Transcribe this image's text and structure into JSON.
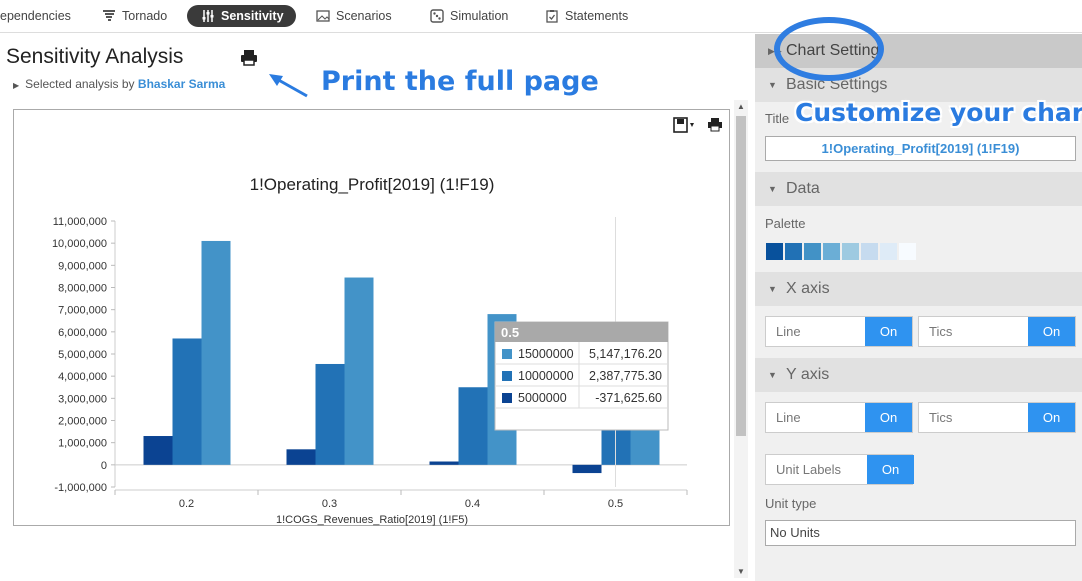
{
  "tabs": [
    {
      "label": "ependencies",
      "icon": "dependencies-icon"
    },
    {
      "label": "Tornado",
      "icon": "tornado-icon"
    },
    {
      "label": "Sensitivity",
      "icon": "sliders-icon"
    },
    {
      "label": "Scenarios",
      "icon": "image-icon"
    },
    {
      "label": "Simulation",
      "icon": "dice-icon"
    },
    {
      "label": "Statements",
      "icon": "clipboard-check-icon"
    }
  ],
  "page": {
    "title": "Sensitivity Analysis",
    "subtitle_prefix": "Selected analysis by",
    "author": "Bhaskar Sarma"
  },
  "annotations": {
    "print": "Print the full page",
    "customize": "Customize your chart"
  },
  "chart_data": {
    "type": "bar",
    "title": "1!Operating_Profit[2019] (1!F19)",
    "xlabel": "1!COGS_Revenues_Ratio[2019] (1!F5)",
    "ylabel": "",
    "categories": [
      "0.2",
      "0.3",
      "0.4",
      "0.5"
    ],
    "series": [
      {
        "name": "5000000",
        "color": "#0b4392",
        "values": [
          1300000,
          700000,
          150000,
          -371625.6
        ]
      },
      {
        "name": "10000000",
        "color": "#2272b6",
        "values": [
          5700000,
          4550000,
          3500000,
          2387775.3
        ]
      },
      {
        "name": "15000000",
        "color": "#4393c8",
        "values": [
          10100000,
          8450000,
          6800000,
          5147176.2
        ]
      }
    ],
    "ylim": [
      -1000000,
      11000000
    ],
    "yticks": [
      "11,000,000",
      "10,000,000",
      "9,000,000",
      "8,000,000",
      "7,000,000",
      "6,000,000",
      "5,000,000",
      "4,000,000",
      "3,000,000",
      "2,000,000",
      "1,000,000",
      "0",
      "-1,000,000"
    ],
    "grid": false,
    "tooltip": {
      "header": "0.5",
      "rows": [
        {
          "key": "15000000",
          "value": "5,147,176.20",
          "color": "#4393c8"
        },
        {
          "key": "10000000",
          "value": "2,387,775.30",
          "color": "#2272b6"
        },
        {
          "key": "5000000",
          "value": "-371,625.60",
          "color": "#0b4392"
        }
      ]
    }
  },
  "settings": {
    "header": "Chart Setting",
    "basic": {
      "label": "Basic Settings",
      "title_label": "Title",
      "title_value": "1!Operating_Profit[2019] (1!F19)"
    },
    "data": {
      "label": "Data",
      "palette_label": "Palette",
      "palette": [
        "#08519c",
        "#2171b5",
        "#4292c6",
        "#6baed6",
        "#9ecae1",
        "#c6dbef",
        "#deebf7",
        "#f7fbff"
      ]
    },
    "xaxis": {
      "label": "X axis",
      "line": "Line",
      "tics": "Tics",
      "on": "On"
    },
    "yaxis": {
      "label": "Y axis",
      "line": "Line",
      "tics": "Tics",
      "on": "On",
      "unit_labels": "Unit Labels",
      "unit_type_label": "Unit type",
      "unit_type_value": "No Units"
    }
  }
}
